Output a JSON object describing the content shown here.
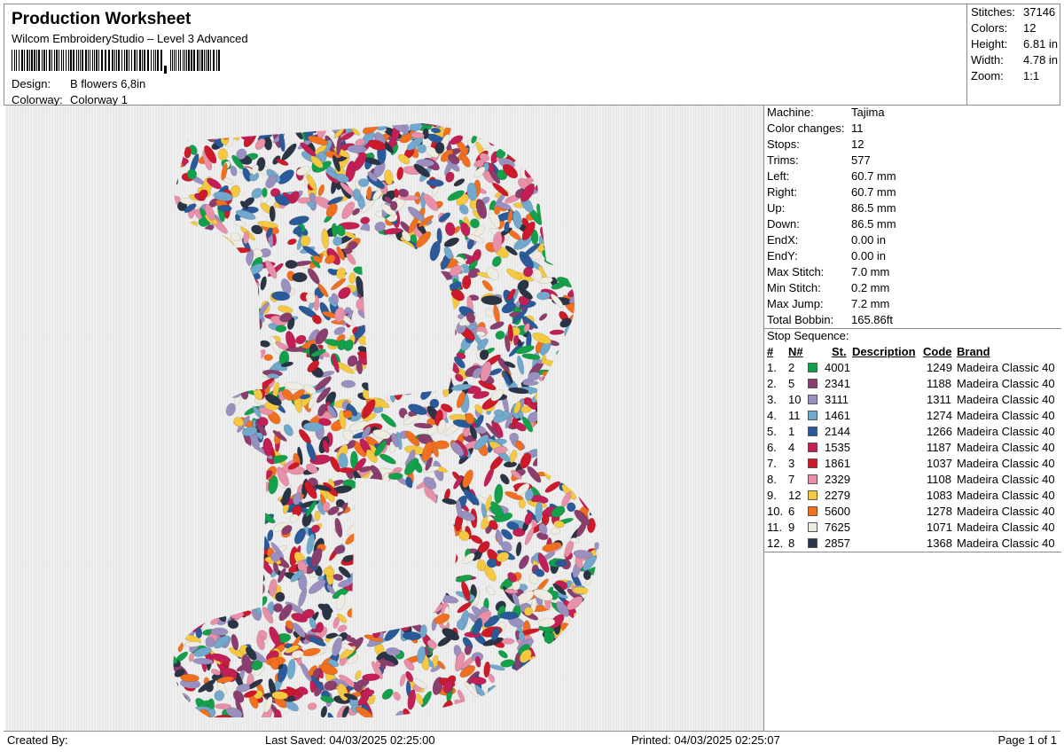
{
  "header": {
    "title": "Production Worksheet",
    "software": "Wilcom EmbroideryStudio – Level 3 Advanced",
    "design_label": "Design:",
    "design_value": "B flowers 6,8in",
    "colorway_label": "Colorway:",
    "colorway_value": "Colorway 1"
  },
  "summary": [
    {
      "label": "Stitches:",
      "value": "37146"
    },
    {
      "label": "Colors:",
      "value": "12"
    },
    {
      "label": "Height:",
      "value": "6.81 in"
    },
    {
      "label": "Width:",
      "value": "4.78 in"
    },
    {
      "label": "Zoom:",
      "value": "1:1"
    }
  ],
  "info": [
    {
      "label": "Machine:",
      "value": "Tajima"
    },
    {
      "label": "Color changes:",
      "value": "11"
    },
    {
      "label": "Stops:",
      "value": "12"
    },
    {
      "label": "Trims:",
      "value": "577"
    },
    {
      "label": "Left:",
      "value": "60.7 mm"
    },
    {
      "label": "Right:",
      "value": "60.7 mm"
    },
    {
      "label": "Up:",
      "value": "86.5 mm"
    },
    {
      "label": "Down:",
      "value": "86.5 mm"
    },
    {
      "label": "EndX:",
      "value": "0.00 in"
    },
    {
      "label": "EndY:",
      "value": "0.00 in"
    },
    {
      "label": "Max Stitch:",
      "value": "7.0 mm"
    },
    {
      "label": "Min Stitch:",
      "value": "0.2 mm"
    },
    {
      "label": "Max Jump:",
      "value": "7.2 mm"
    },
    {
      "label": "Total Bobbin:",
      "value": "165.86ft"
    }
  ],
  "stop_sequence": {
    "title": "Stop Sequence:",
    "columns": {
      "num": "#",
      "needle": "N#",
      "stitches": "St.",
      "description": "Description",
      "code": "Code",
      "brand": "Brand"
    },
    "rows": [
      {
        "num": "1.",
        "needle": "2",
        "color": "#14a04a",
        "stitches": "4001",
        "code": "1249",
        "brand": "Madeira Classic 40"
      },
      {
        "num": "2.",
        "needle": "5",
        "color": "#8a3e6e",
        "stitches": "2341",
        "code": "1188",
        "brand": "Madeira Classic 40"
      },
      {
        "num": "3.",
        "needle": "10",
        "color": "#9a90c0",
        "stitches": "3111",
        "code": "1311",
        "brand": "Madeira Classic 40"
      },
      {
        "num": "4.",
        "needle": "11",
        "color": "#72a8cc",
        "stitches": "1461",
        "code": "1274",
        "brand": "Madeira Classic 40"
      },
      {
        "num": "5.",
        "needle": "1",
        "color": "#2a5a9a",
        "stitches": "2144",
        "code": "1266",
        "brand": "Madeira Classic 40"
      },
      {
        "num": "6.",
        "needle": "4",
        "color": "#c21f55",
        "stitches": "1535",
        "code": "1187",
        "brand": "Madeira Classic 40"
      },
      {
        "num": "7.",
        "needle": "3",
        "color": "#cc1a2a",
        "stitches": "1861",
        "code": "1037",
        "brand": "Madeira Classic 40"
      },
      {
        "num": "8.",
        "needle": "7",
        "color": "#e890a8",
        "stitches": "2329",
        "code": "1108",
        "brand": "Madeira Classic 40"
      },
      {
        "num": "9.",
        "needle": "12",
        "color": "#f5c842",
        "stitches": "2279",
        "code": "1083",
        "brand": "Madeira Classic 40"
      },
      {
        "num": "10.",
        "needle": "6",
        "color": "#f07020",
        "stitches": "5600",
        "code": "1278",
        "brand": "Madeira Classic 40"
      },
      {
        "num": "11.",
        "needle": "9",
        "color": "#eeece0",
        "stitches": "7625",
        "code": "1071",
        "brand": "Madeira Classic 40"
      },
      {
        "num": "12.",
        "needle": "8",
        "color": "#2a3444",
        "stitches": "2857",
        "code": "1368",
        "brand": "Madeira Classic 40"
      }
    ]
  },
  "footer": {
    "created_by": "Created By:",
    "last_saved": "Last Saved: 04/03/2025 02:25:00",
    "printed": "Printed: 04/03/2025 02:25:07",
    "page": "Page 1 of 1"
  }
}
